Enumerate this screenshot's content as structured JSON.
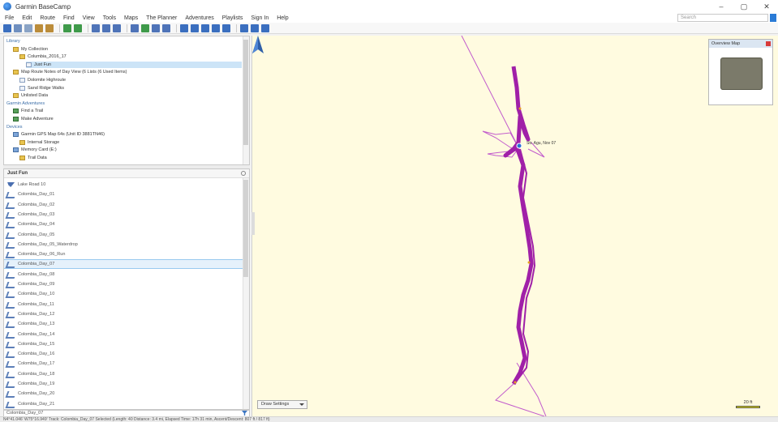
{
  "window": {
    "title": "Garmin BaseCamp",
    "controls": [
      "–",
      "▢",
      "✕"
    ]
  },
  "menu": [
    "File",
    "Edit",
    "Route",
    "Find",
    "View",
    "Tools",
    "Maps",
    "The Planner",
    "Adventures",
    "Playlists",
    "Sign In",
    "Help"
  ],
  "search": {
    "placeholder": "Search"
  },
  "library": {
    "rows": [
      {
        "label": "Library",
        "kind": "header",
        "indent": 0
      },
      {
        "label": "My Collection",
        "kind": "folder",
        "indent": 1
      },
      {
        "label": "Columbia_2016_17",
        "kind": "folder",
        "indent": 2
      },
      {
        "label": "Just Fun",
        "kind": "doc",
        "indent": 3,
        "selected": true
      },
      {
        "label": "Map Route Notes of Day View (6 Lists (6 Used Items)",
        "kind": "folder",
        "indent": 1
      },
      {
        "label": "Dolomite Highroute",
        "kind": "doc",
        "indent": 2
      },
      {
        "label": "Sand Ridge Walks",
        "kind": "doc",
        "indent": 2
      },
      {
        "label": "Unlisted Data",
        "kind": "folder",
        "indent": 1
      },
      {
        "label": "Garmin Adventures",
        "kind": "header",
        "indent": 0
      },
      {
        "label": "Find a Trail",
        "kind": "geo",
        "indent": 1
      },
      {
        "label": "Make Adventure",
        "kind": "geo",
        "indent": 1
      },
      {
        "label": "Devices",
        "kind": "header",
        "indent": 0
      },
      {
        "label": "Garmin GPS Map 64s (Unit ID 3881TN46)",
        "kind": "db",
        "indent": 1
      },
      {
        "label": "Internal Storage",
        "kind": "folder",
        "indent": 2
      },
      {
        "label": "Memory Card (E:)",
        "kind": "db",
        "indent": 1
      },
      {
        "label": "Trail Data",
        "kind": "folder",
        "indent": 2
      }
    ]
  },
  "list": {
    "header": "Just Fun",
    "items": [
      {
        "label": "Lake Road 10",
        "icon": "lake"
      },
      {
        "label": "Colombia_Day_01",
        "icon": "track"
      },
      {
        "label": "Colombia_Day_02",
        "icon": "track"
      },
      {
        "label": "Colombia_Day_03",
        "icon": "track"
      },
      {
        "label": "Colombia_Day_04",
        "icon": "track"
      },
      {
        "label": "Colombia_Day_05",
        "icon": "track"
      },
      {
        "label": "Colombia_Day_05_Waterdrop",
        "icon": "track"
      },
      {
        "label": "Colombia_Day_06_Run",
        "icon": "track"
      },
      {
        "label": "Colombia_Day_07",
        "icon": "track",
        "selected": true
      },
      {
        "label": "Colombia_Day_08",
        "icon": "track"
      },
      {
        "label": "Colombia_Day_09",
        "icon": "track"
      },
      {
        "label": "Colombia_Day_10",
        "icon": "track"
      },
      {
        "label": "Colombia_Day_11",
        "icon": "track"
      },
      {
        "label": "Colombia_Day_12",
        "icon": "track"
      },
      {
        "label": "Colombia_Day_13",
        "icon": "track"
      },
      {
        "label": "Colombia_Day_14",
        "icon": "track"
      },
      {
        "label": "Colombia_Day_15",
        "icon": "track"
      },
      {
        "label": "Colombia_Day_16",
        "icon": "track"
      },
      {
        "label": "Colombia_Day_17",
        "icon": "track"
      },
      {
        "label": "Colombia_Day_18",
        "icon": "track"
      },
      {
        "label": "Colombia_Day_19",
        "icon": "track"
      },
      {
        "label": "Colombia_Day_20",
        "icon": "track"
      },
      {
        "label": "Colombia_Day_21",
        "icon": "track"
      }
    ]
  },
  "filter": {
    "value": "Colombia_Day_07"
  },
  "map": {
    "waypoint_label": "Str. Agu, Nov 07",
    "overview_title": "Overview Map",
    "draw_settings": "Draw Settings",
    "scale_label": "20 ft",
    "track_color": "#a020a8",
    "thin_track_color": "#c25ccc"
  },
  "status": {
    "text": "N4°41.046' W75°16.949'    Track: Colombia_Day_07 Selected (Length: 40 Distance: 3.4 mi, Elapsed Time: 17h 31 min, Ascent/Descent: 807 ft / 817 ft)"
  }
}
